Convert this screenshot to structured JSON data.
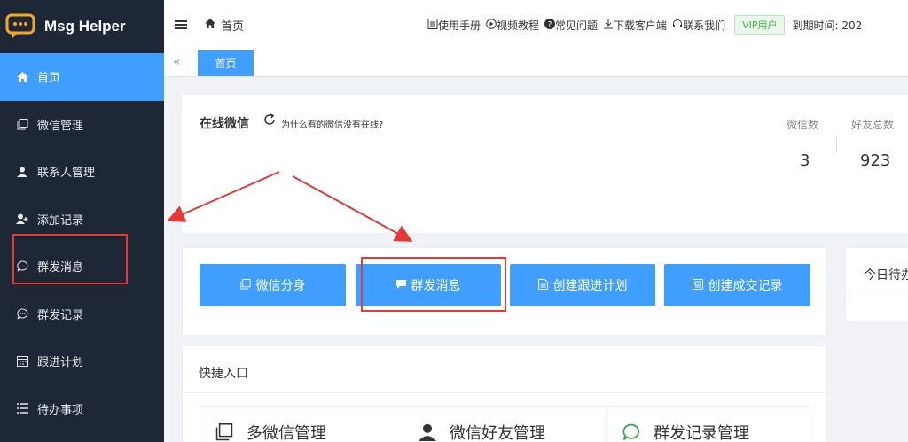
{
  "app": {
    "name": "Msg Helper"
  },
  "sidebar": {
    "items": [
      {
        "label": "首页",
        "icon": "home-icon",
        "active": true
      },
      {
        "label": "微信管理",
        "icon": "copy-icon"
      },
      {
        "label": "联系人管理",
        "icon": "user-icon"
      },
      {
        "label": "添加记录",
        "icon": "user-add-icon"
      },
      {
        "label": "群发消息",
        "icon": "chat-icon"
      },
      {
        "label": "群发记录",
        "icon": "chat-dots-icon"
      },
      {
        "label": "跟进计划",
        "icon": "calendar-icon"
      },
      {
        "label": "待办事项",
        "icon": "list-icon"
      }
    ]
  },
  "header": {
    "breadcrumb": "首页",
    "links": [
      "使用手册",
      "视频教程",
      "常见问题",
      "下载客户端",
      "联系我们"
    ],
    "vip_badge": "VIP用户",
    "expire": "到期时间: 202"
  },
  "tabs": {
    "home": "首页"
  },
  "online": {
    "title": "在线微信",
    "why": "为什么有的微信没有在线?",
    "stats": [
      {
        "label": "微信数",
        "value": "3"
      },
      {
        "label": "好友总数",
        "value": "923"
      }
    ]
  },
  "actions": [
    "微信分身",
    "群发消息",
    "创建跟进计划",
    "创建成交记录"
  ],
  "todo": {
    "title": "今日待办"
  },
  "quick": {
    "title": "快捷入口",
    "items": [
      "多微信管理",
      "微信好友管理",
      "群发记录管理"
    ]
  },
  "colors": {
    "sidebar": "#1d2735",
    "accent": "#409eff",
    "annotation": "#e53935"
  }
}
